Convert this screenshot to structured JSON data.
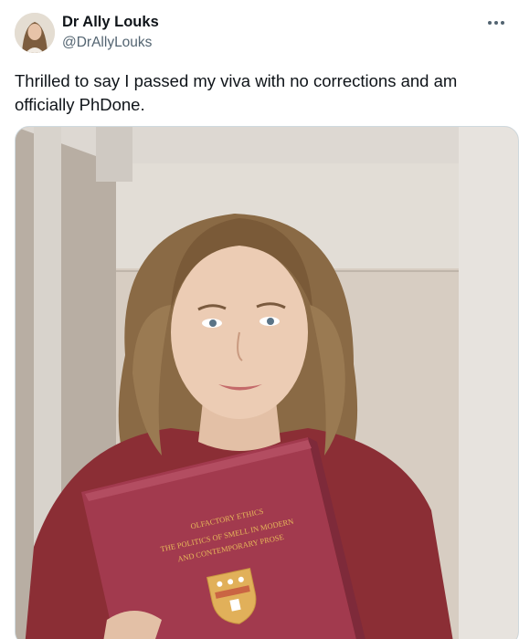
{
  "post": {
    "author": {
      "name": "Dr Ally Louks",
      "handle": "@DrAllyLouks"
    },
    "text": "Thrilled to say I passed my viva with no corrections and am officially PhDone.",
    "more_icon": "more-horizontal-icon",
    "photo": {
      "thesis_title_line1": "OLFACTORY ETHICS",
      "thesis_title_line2": "THE POLITICS OF SMELL IN MODERN",
      "thesis_title_line3": "AND CONTEMPORARY PROSE",
      "thesis_cover_color": "#a23a4e",
      "sweater_color": "#8b2e35",
      "hair_color": "#8a6a45"
    }
  }
}
